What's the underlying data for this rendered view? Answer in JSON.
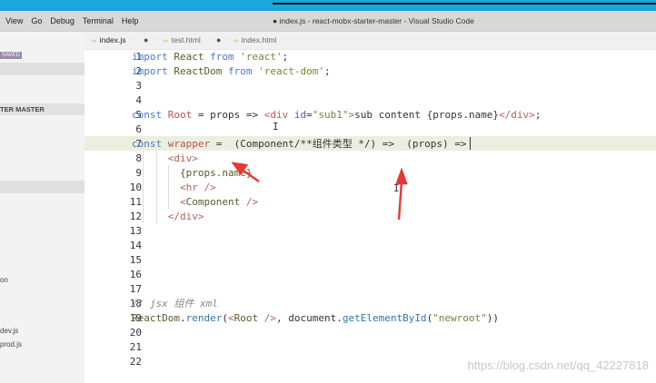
{
  "menu": [
    "View",
    "Go",
    "Debug",
    "Terminal",
    "Help"
  ],
  "window_title": "● index.js - react-mobx-starter-master - Visual Studio Code",
  "sidebar": {
    "badge": "SAVED",
    "section": "TER MASTER",
    "items": [
      "on",
      "dev.js",
      "prod.js"
    ]
  },
  "tabs": [
    {
      "label": "index.js",
      "icon": "js-icon",
      "dirty": true
    },
    {
      "label": "test.html",
      "icon": "html-icon",
      "dirty": true
    },
    {
      "label": "index.html",
      "icon": "html-icon",
      "dirty": false
    }
  ],
  "editor": {
    "line_numbers": [
      "1",
      "2",
      "3",
      "4",
      "5",
      "6",
      "7",
      "8",
      "9",
      "10",
      "11",
      "12",
      "13",
      "14",
      "15",
      "16",
      "17",
      "18",
      "19",
      "20",
      "21",
      "22"
    ],
    "current_line": 7
  },
  "watermark": "https://blog.csdn.net/qq_42227818",
  "annotations": {
    "arrow_color": "#e53935"
  }
}
